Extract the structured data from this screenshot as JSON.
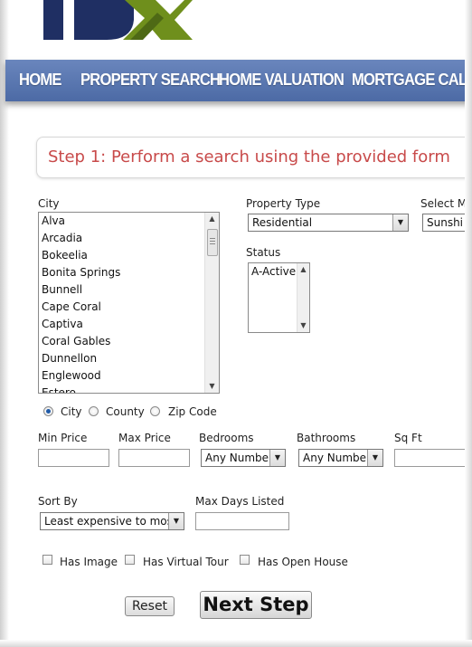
{
  "nav": {
    "items": [
      "HOME",
      "PROPERTY SEARCH",
      "HOME VALUATION",
      "MORTGAGE CALCU"
    ]
  },
  "step": {
    "title": "Step 1: Perform a search using the provided form"
  },
  "form": {
    "city_label": "City",
    "cities": [
      "Alva",
      "Arcadia",
      "Bokeelia",
      "Bonita Springs",
      "Bunnell",
      "Cape Coral",
      "Captiva",
      "Coral Gables",
      "Dunnellon",
      "Englewood",
      "Estero"
    ],
    "property_type_label": "Property Type",
    "property_type_value": "Residential",
    "select_label": "Select M",
    "select_value": "Sunshi",
    "status_label": "Status",
    "status_options": [
      "A-Active"
    ],
    "location_modes": [
      "City",
      "County",
      "Zip Code"
    ],
    "selected_location_mode": "City",
    "min_price_label": "Min Price",
    "max_price_label": "Max Price",
    "bedrooms_label": "Bedrooms",
    "bedrooms_value": "Any Number",
    "bathrooms_label": "Bathrooms",
    "bathrooms_value": "Any Number",
    "sqft_label": "Sq Ft",
    "sort_label": "Sort By",
    "sort_value": "Least expensive to most",
    "max_days_label": "Max Days Listed",
    "checkboxes": [
      "Has Image",
      "Has Virtual Tour",
      "Has Open House"
    ],
    "reset_label": "Reset",
    "next_label": "Next Step"
  },
  "colors": {
    "nav_bar": "#5a76b1",
    "step_title": "#c84a4a",
    "logo_navy": "#1f2f63",
    "logo_green": "#6f8f1c"
  }
}
